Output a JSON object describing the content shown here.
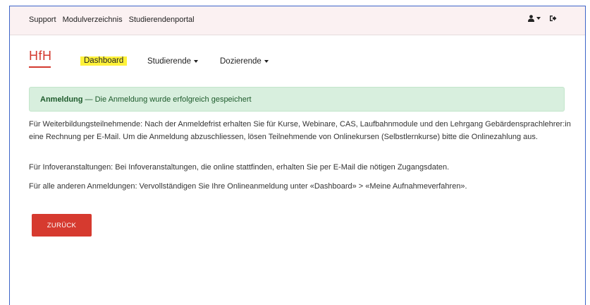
{
  "topbar": {
    "links": [
      "Support",
      "Modulverzeichnis",
      "Studierendenportal"
    ]
  },
  "nav": {
    "logo": "HfH",
    "items": [
      {
        "label": "Dashboard"
      },
      {
        "label": "Studierende"
      },
      {
        "label": "Dozierende"
      }
    ]
  },
  "alert": {
    "title": "Anmeldung",
    "message": " — Die Anmeldung wurde erfolgreich gespeichert"
  },
  "content": {
    "p1": "Für Weiterbildungsteilnehmende: Nach der Anmeldefrist erhalten Sie für Kurse, Webinare, CAS, Laufbahnmodule und den Lehrgang Gebärdensprachlehrer:in eine Rechnung per E-Mail. Um die Anmeldung abzuschliessen, lösen Teilnehmende von Onlinekursen (Selbstlernkurse) bitte die Onlinezahlung aus.",
    "p2": "Für Infoveranstaltungen: Bei Infoveranstaltungen, die online stattfinden, erhalten Sie per E-Mail die nötigen Zugangsdaten.",
    "p3": "Für alle anderen Anmeldungen: Vervollständigen Sie Ihre Onlineanmeldung unter «Dashboard» > «Meine Aufnahmeverfahren»."
  },
  "back_button": "ZURÜCK",
  "colors": {
    "brand": "#d33a2f",
    "highlight": "#fff23a",
    "alert_bg": "#d8efde"
  }
}
